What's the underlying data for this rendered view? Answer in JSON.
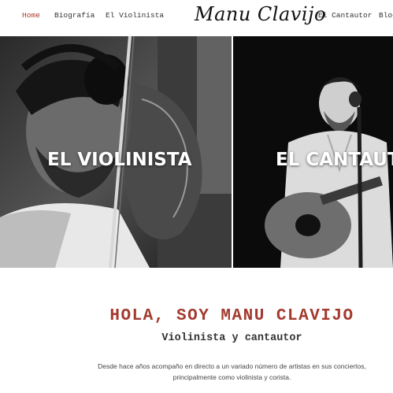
{
  "nav": {
    "items": [
      {
        "label": "Home",
        "active": true
      },
      {
        "label": "Biografía",
        "active": false
      },
      {
        "label": "El Violinista",
        "active": false
      },
      {
        "label": "El Cantautor",
        "active": false
      },
      {
        "label": "Blog",
        "active": false
      }
    ],
    "logo": "Manu Clavijo",
    "accent_color": "#b0392b"
  },
  "hero": {
    "left_label": "EL VIOLINISTA",
    "right_label": "EL CANTAUTOR"
  },
  "intro": {
    "title": "HOLA, SOY MANU CLAVIJO",
    "subtitle": "Violinista y cantautor",
    "text_line1": "Desde hace años acompaño en directo a un variado número de artistas en sus conciertos,",
    "text_line2": "principalmente como violinista y corista."
  }
}
